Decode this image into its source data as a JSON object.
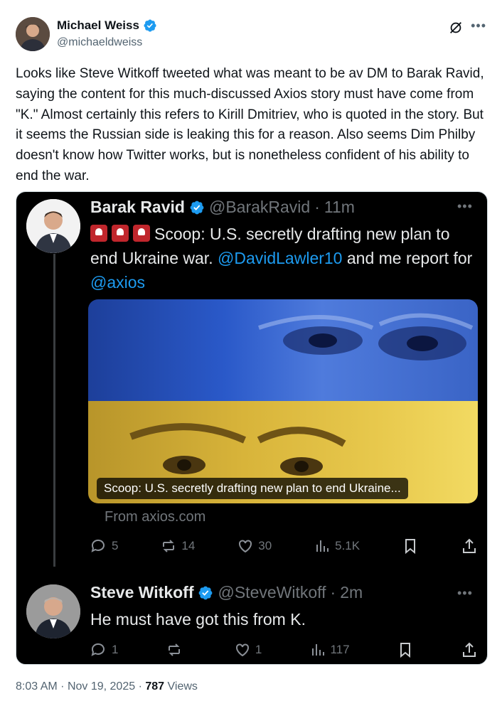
{
  "author": {
    "name": "Michael Weiss",
    "handle": "@michaeldweiss"
  },
  "tweet": {
    "text": "Looks like Steve Witkoff tweeted what was meant to be av DM to Barak Ravid, saying the content for this much-discussed Axios story must have come from \"K.\" Almost certainly this refers to Kirill Dmitriev, who is quoted in the story. But it seems the Russian side is leaking this for a reason. Also seems Dim Philby doesn't know how Twitter works, but is nonetheless confident of his ability to end the war.",
    "time": "8:03 AM",
    "date": "Nov 19, 2025",
    "views_count": "787",
    "views_label": "Views",
    "separator": "·"
  },
  "quoted_post": {
    "author": "Barak Ravid",
    "handle": "@BarakRavid",
    "age": "11m",
    "text_lead": "Scoop: U.S. secretly drafting new plan to end Ukraine war. ",
    "mention_1": "@DavidLawler10",
    "text_mid": " and me report for ",
    "mention_2": "@axios",
    "card_caption": "Scoop: U.S. secretly drafting new plan to end Ukraine...",
    "card_source": "From axios.com",
    "replies": "5",
    "reposts": "14",
    "likes": "30",
    "views": "5.1K"
  },
  "reply_post": {
    "author": "Steve Witkoff",
    "handle": "@SteveWitkoff",
    "age": "2m",
    "text": "He must have got this from K.",
    "replies": "1",
    "reposts": "",
    "likes": "1",
    "views": "117"
  },
  "icons": {
    "more": "more-icon",
    "grok": "grok-icon",
    "verified": "verified-badge-icon",
    "reply": "reply-icon",
    "repost": "repost-icon",
    "like": "like-icon",
    "views": "views-icon",
    "bookmark": "bookmark-icon",
    "share": "share-icon"
  },
  "colors": {
    "verified": "#1d9bf0",
    "link": "#1d9bf0",
    "secondary_text": "#536471",
    "dark_bg": "#000000"
  }
}
